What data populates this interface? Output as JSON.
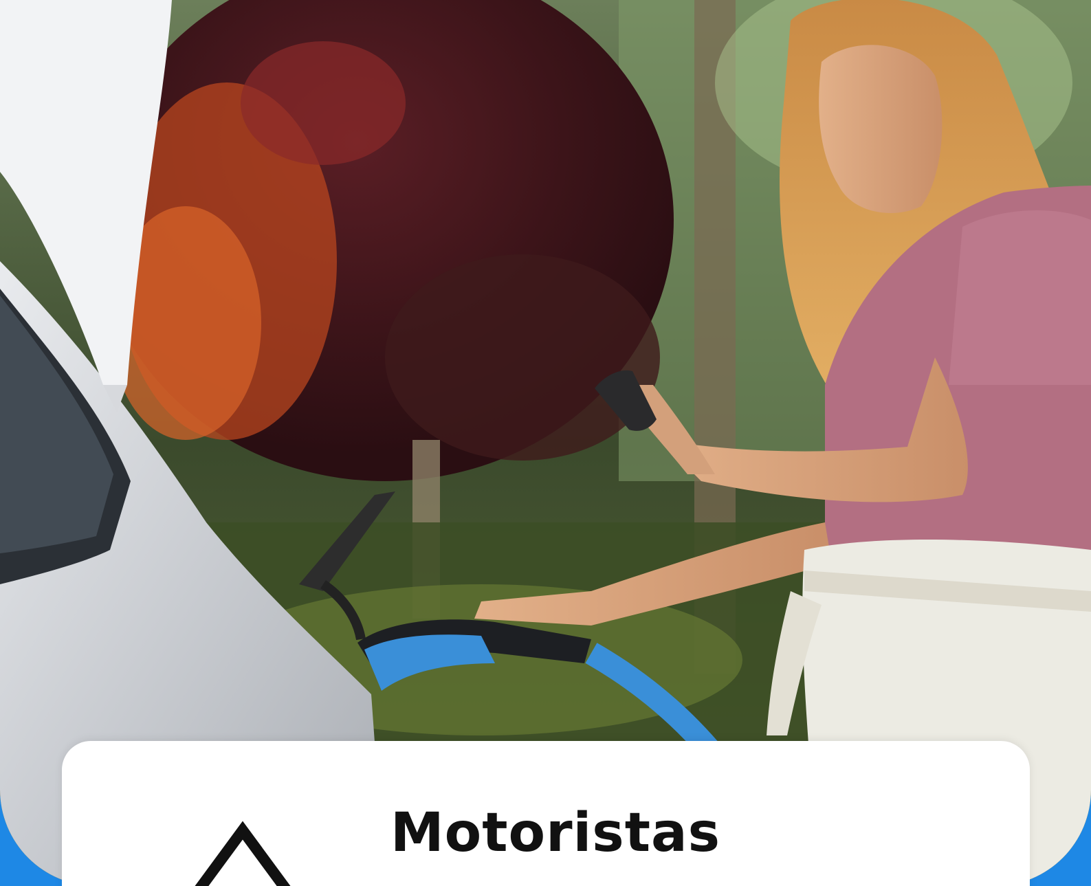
{
  "card": {
    "title": "Motoristas"
  },
  "photo": {
    "subject": "woman-charging-electric-car"
  },
  "colors": {
    "frame": "#1e88e5",
    "card": "#ffffff",
    "title": "#111111",
    "charger": "#3a8fd8",
    "shirt": "#b36f82"
  }
}
